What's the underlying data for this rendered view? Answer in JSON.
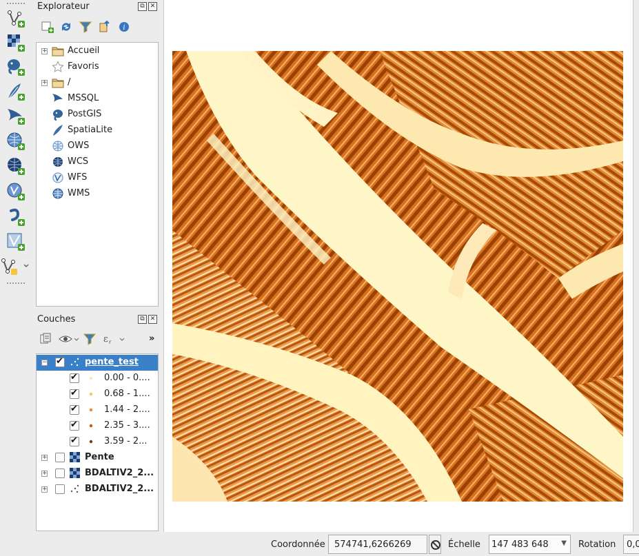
{
  "explorer": {
    "title": "Explorateur",
    "items": [
      {
        "label": "Accueil",
        "icon": "folder-icon",
        "expandable": true
      },
      {
        "label": "Favoris",
        "icon": "star-icon",
        "expandable": false
      },
      {
        "label": "/",
        "icon": "folder-icon",
        "expandable": true
      },
      {
        "label": "MSSQL",
        "icon": "mssql-icon",
        "expandable": false
      },
      {
        "label": "PostGIS",
        "icon": "postgis-elephant-icon",
        "expandable": false
      },
      {
        "label": "SpatiaLite",
        "icon": "spatialite-feather-icon",
        "expandable": false
      },
      {
        "label": "OWS",
        "icon": "ows-globe-icon",
        "expandable": false
      },
      {
        "label": "WCS",
        "icon": "wcs-globe-icon",
        "expandable": false
      },
      {
        "label": "WFS",
        "icon": "wfs-globe-icon",
        "expandable": false
      },
      {
        "label": "WMS",
        "icon": "wms-globe-icon",
        "expandable": false
      }
    ]
  },
  "layers": {
    "title": "Couches",
    "overflow": "»",
    "items": [
      {
        "label": "pente_test",
        "checked": true,
        "selected": true,
        "expandable": true
      },
      {
        "label": "0.00 - 0....",
        "checked": true,
        "dot_color": "#ffe9a8"
      },
      {
        "label": "0.68 - 1....",
        "checked": true,
        "dot_color": "#f7c46a"
      },
      {
        "label": "1.44 - 2....",
        "checked": true,
        "dot_color": "#e58a2a"
      },
      {
        "label": "2.35 - 3....",
        "checked": true,
        "dot_color": "#c25a12"
      },
      {
        "label": "3.59 - 2...",
        "checked": true,
        "dot_color": "#8a3506"
      },
      {
        "label": "Pente",
        "checked": false,
        "expandable": true,
        "bold": true
      },
      {
        "label": "BDALTIV2_2...",
        "checked": false,
        "expandable": true,
        "bold": true
      },
      {
        "label": "BDALTIV2_2...",
        "checked": false,
        "expandable": true,
        "bold": true
      }
    ]
  },
  "status": {
    "coord_label": "Coordonnée",
    "coord_value": "574741,6266269",
    "scale_label": "Échelle",
    "scale_value": "147 483 648",
    "rotation_label": "Rotation",
    "rotation_value": "0,0"
  },
  "colors": {
    "selection": "#3a80c8",
    "slope_light": "#fff7c8",
    "slope_dark": "#a84a05"
  }
}
